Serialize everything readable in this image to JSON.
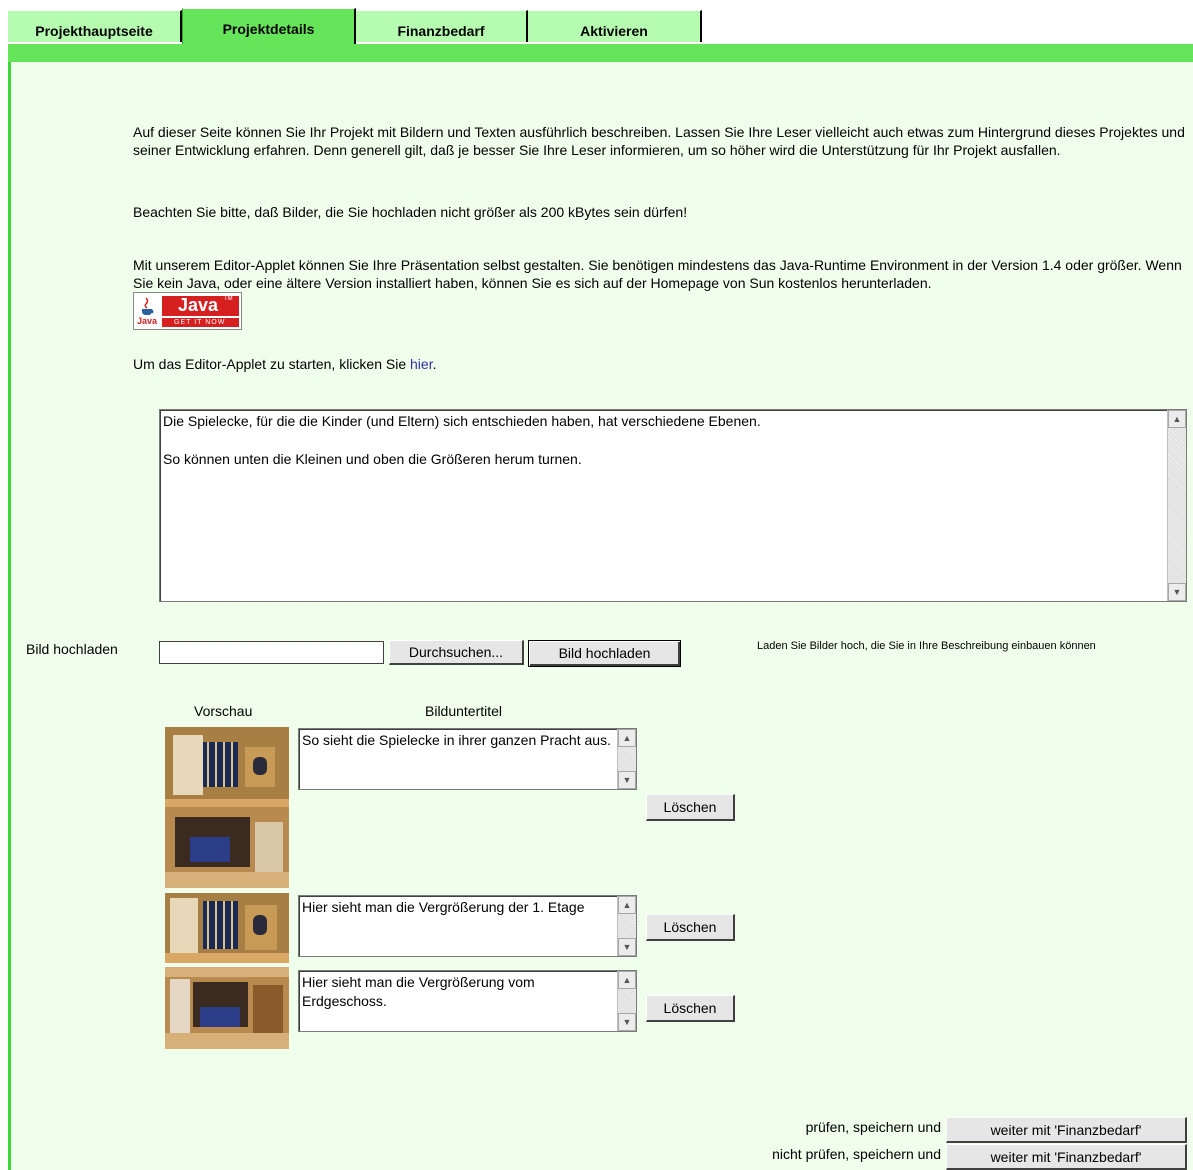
{
  "tabs": [
    {
      "label": "Projekthauptseite",
      "active": false
    },
    {
      "label": "Projektdetails",
      "active": true
    },
    {
      "label": "Finanzbedarf",
      "active": false
    },
    {
      "label": "Aktivieren",
      "active": false
    }
  ],
  "intro": {
    "para1": "Auf dieser Seite können Sie Ihr Projekt mit Bildern und Texten ausführlich beschreiben. Lassen Sie Ihre Leser vielleicht auch etwas zum Hintergrund dieses Projektes und seiner Entwicklung erfahren. Denn generell gilt, daß je besser Sie Ihre Leser informieren, um so höher wird die Unterstützung für Ihr Projekt ausfallen.",
    "para2": "Beachten Sie bitte, daß Bilder, die Sie hochladen nicht größer als 200 kBytes sein dürfen!",
    "para3": "Mit unserem Editor-Applet können Sie Ihre Präsentation selbst gestalten. Sie benötigen mindestens das Java-Runtime Environment in der Version 1.4 oder größer. Wenn Sie kein Java, oder eine ältere Version installiert haben, können Sie es sich auf der Homepage von Sun kostenlos herunterladen.",
    "java_badge_big": "Java",
    "java_badge_small": "Java",
    "java_badge_tm": "TM",
    "java_badge_getit": "GET IT NOW",
    "applet_prefix": "Um das Editor-Applet zu starten, klicken Sie ",
    "applet_link": "hier",
    "applet_suffix": "."
  },
  "description": {
    "line1": "Die Spielecke, für die die Kinder (und Eltern) sich entschieden haben, hat verschiedene Ebenen.",
    "line2": "So können unten die Kleinen und oben die Größeren herum turnen."
  },
  "upload": {
    "label": "Bild hochladen",
    "file_value": "",
    "browse_label": "Durchsuchen...",
    "upload_button": "Bild hochladen",
    "hint": "Laden Sie Bilder hoch, die Sie in Ihre Beschreibung einbauen können"
  },
  "images": {
    "preview_header": "Vorschau",
    "caption_header": "Bilduntertitel",
    "items": [
      {
        "caption": "So sieht die Spielecke in ihrer ganzen Pracht aus.",
        "delete": "Löschen"
      },
      {
        "caption": "Hier sieht man die Vergrößerung der 1. Etage",
        "delete": "Löschen"
      },
      {
        "caption": "Hier sieht man die Vergrößerung vom Erdgeschoss.",
        "delete": "Löschen"
      }
    ]
  },
  "footer": {
    "row1_label": "prüfen, speichern und",
    "row1_button": "weiter mit 'Finanzbedarf'",
    "row2_label": "nicht prüfen, speichern und",
    "row2_button": "weiter mit 'Finanzbedarf'"
  }
}
